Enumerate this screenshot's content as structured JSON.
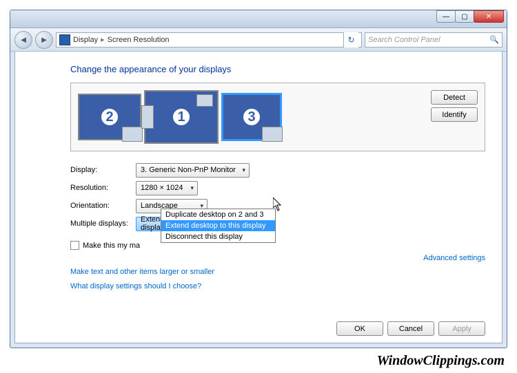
{
  "titlebar": {
    "minimize": "—",
    "maximize": "▢",
    "close": "✕"
  },
  "nav": {
    "back": "◄",
    "forward": "►",
    "crumb1": "Display",
    "crumb2": "Screen Resolution",
    "refresh": "↻",
    "search_placeholder": "Search Control Panel"
  },
  "page": {
    "title": "Change the appearance of your displays",
    "detect": "Detect",
    "identify": "Identify",
    "monitors": {
      "m1": "1",
      "m2": "2",
      "m3": "3"
    },
    "labels": {
      "display": "Display:",
      "resolution": "Resolution:",
      "orientation": "Orientation:",
      "multiple": "Multiple displays:"
    },
    "values": {
      "display": "3. Generic Non-PnP Monitor",
      "resolution": "1280 × 1024",
      "orientation": "Landscape",
      "multiple": "Extend desktop to this display"
    },
    "dropdown_options": {
      "o1": "Duplicate desktop on 2 and 3",
      "o2": "Extend desktop to this display",
      "o3": "Disconnect this display"
    },
    "make_main": "Make this my ma",
    "advanced": "Advanced settings",
    "link1": "Make text and other items larger or smaller",
    "link2": "What display settings should I choose?",
    "ok": "OK",
    "cancel": "Cancel",
    "apply": "Apply"
  },
  "watermark": "WindowClippings.com"
}
